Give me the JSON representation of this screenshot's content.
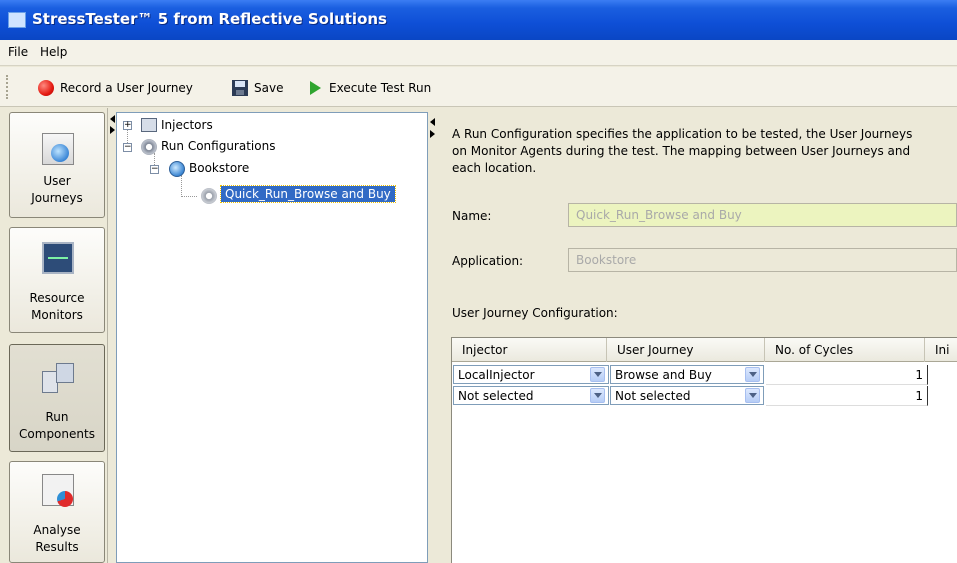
{
  "window": {
    "title": "StressTester™ 5  from Reflective Solutions"
  },
  "menu": {
    "file": "File",
    "help": "Help"
  },
  "toolbar": {
    "record_label": "Record a User Journey",
    "save_label": "Save",
    "execute_label": "Execute Test Run"
  },
  "nav": {
    "user_journeys": {
      "line1": "User",
      "line2": "Journeys"
    },
    "resource_monitors": {
      "line1": "Resource",
      "line2": "Monitors"
    },
    "run_components": {
      "line1": "Run",
      "line2": "Components"
    },
    "analyse_results": {
      "line1": "Analyse",
      "line2": "Results"
    }
  },
  "tree": {
    "injectors": "Injectors",
    "run_configurations": "Run Configurations",
    "bookstore": "Bookstore",
    "selected_node": "Quick_Run_Browse and Buy"
  },
  "details": {
    "description_line1": "A Run Configuration specifies the application to be tested, the User Journeys",
    "description_line2": "on Monitor Agents during the test.  The mapping between User Journeys and",
    "description_line3": "each location.",
    "name_label": "Name:",
    "name_value": "Quick_Run_Browse and Buy",
    "application_label": "Application:",
    "application_value": "Bookstore",
    "ujc_label": "User Journey Configuration:"
  },
  "grid": {
    "columns": [
      "Injector",
      "User Journey",
      "No. of Cycles",
      "Ini"
    ],
    "rows": [
      {
        "injector": "LocalInjector",
        "journey": "Browse and Buy",
        "cycles": "1"
      },
      {
        "injector": "Not selected",
        "journey": "Not selected",
        "cycles": "1"
      }
    ]
  },
  "colors": {
    "title_bar": "#0e4fd6",
    "selection": "#316ac5",
    "name_field_bg": "#ecf4bf"
  }
}
